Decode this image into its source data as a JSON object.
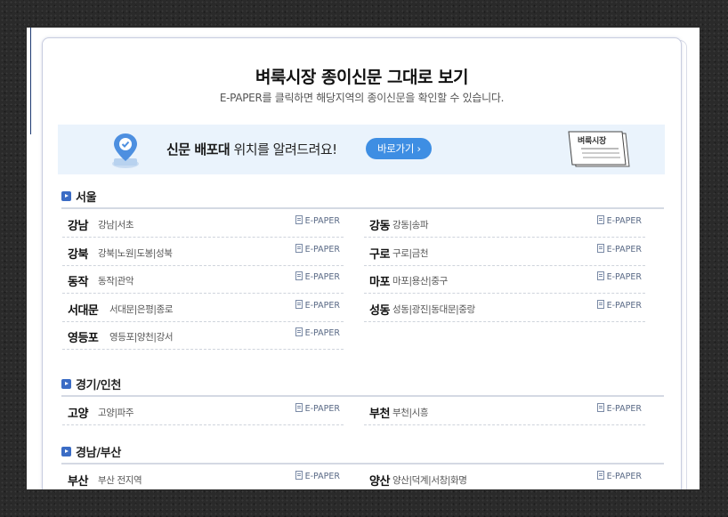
{
  "page": {
    "title": "벼룩시장 종이신문 그대로 보기",
    "subtitle": "E-PAPER를 클릭하면 해당지역의 종이신문을 확인할 수 있습니다."
  },
  "banner": {
    "text_bold": "신문 배포대",
    "text_rest": " 위치를 알려드려요!",
    "button_label": "바로가기 ›",
    "paper_label": "벼룩시장"
  },
  "sections": [
    {
      "title": "서울",
      "rows": [
        {
          "name": "강남",
          "areas": "강남|서초",
          "epaper": "E-PAPER"
        },
        {
          "name": "강동",
          "areas": "강동|송파",
          "epaper": "E-PAPER"
        },
        {
          "name": "강북",
          "areas": "강북|노원|도봉|성북",
          "epaper": "E-PAPER"
        },
        {
          "name": "구로",
          "areas": "구로|금천",
          "epaper": "E-PAPER"
        },
        {
          "name": "동작",
          "areas": "동작|관악",
          "epaper": "E-PAPER"
        },
        {
          "name": "마포",
          "areas": "마포|용산|중구",
          "epaper": "E-PAPER"
        },
        {
          "name": "서대문",
          "areas": "서대문|은평|종로",
          "epaper": "E-PAPER"
        },
        {
          "name": "성동",
          "areas": "성동|광진|동대문|중랑",
          "epaper": "E-PAPER"
        },
        {
          "name": "영등포",
          "areas": "영등포|양천|강서",
          "epaper": "E-PAPER"
        }
      ]
    },
    {
      "title": "경기/인천",
      "rows": [
        {
          "name": "고양",
          "areas": "고양|파주",
          "epaper": "E-PAPER"
        },
        {
          "name": "부천",
          "areas": "부천|시흥",
          "epaper": "E-PAPER"
        }
      ]
    },
    {
      "title": "경남/부산",
      "rows": [
        {
          "name": "부산",
          "areas": "부산 전지역",
          "epaper": "E-PAPER"
        },
        {
          "name": "양산",
          "areas": "양산|덕계|서창|화명",
          "epaper": "E-PAPER"
        }
      ]
    }
  ],
  "colors": {
    "accent": "#3e8ee3",
    "banner_bg": "#eaf3fc",
    "section_icon": "#3b6cc5"
  },
  "icons": {
    "banner_pin": "location-pin-icon",
    "banner_paper": "newspaper-icon",
    "section": "play-square-icon",
    "epaper": "document-icon"
  }
}
